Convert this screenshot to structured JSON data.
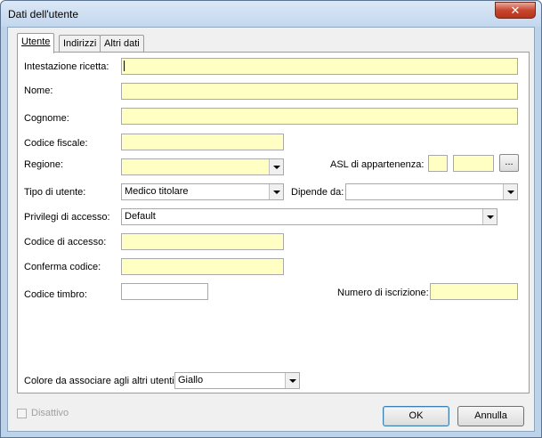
{
  "window": {
    "title": "Dati dell'utente",
    "close_symbol": "✕"
  },
  "tabs": [
    "Utente",
    "Indirizzi",
    "Altri dati"
  ],
  "form": {
    "intestazione_label": "Intestazione ricetta:",
    "intestazione_value": "",
    "nome_label": "Nome:",
    "nome_value": "",
    "cognome_label": "Cognome:",
    "cognome_value": "",
    "codice_fiscale_label": "Codice fiscale:",
    "codice_fiscale_value": "",
    "regione_label": "Regione:",
    "regione_value": "",
    "asl_label": "ASL di appartenenza:",
    "asl_value_1": "",
    "asl_value_2": "",
    "asl_browse": "...",
    "tipo_utente_label": "Tipo di utente:",
    "tipo_utente_value": "Medico titolare",
    "dipende_da_label": "Dipende da:",
    "dipende_da_value": "",
    "privilegi_label": "Privilegi di accesso:",
    "privilegi_value": "Default",
    "codice_accesso_label": "Codice di accesso:",
    "codice_accesso_value": "",
    "conferma_codice_label": "Conferma codice:",
    "conferma_codice_value": "",
    "codice_timbro_label": "Codice timbro:",
    "codice_timbro_value": "",
    "numero_iscrizione_label": "Numero di iscrizione:",
    "numero_iscrizione_value": "",
    "colore_label": "Colore da associare agli altri utenti:",
    "colore_value": "Giallo"
  },
  "footer": {
    "disattivo_label": "Disattivo",
    "ok_label": "OK",
    "annulla_label": "Annulla"
  },
  "colors": {
    "field_bg": "#ffffc4",
    "titlebar": "#c3d7ee",
    "close": "#c7462f"
  }
}
